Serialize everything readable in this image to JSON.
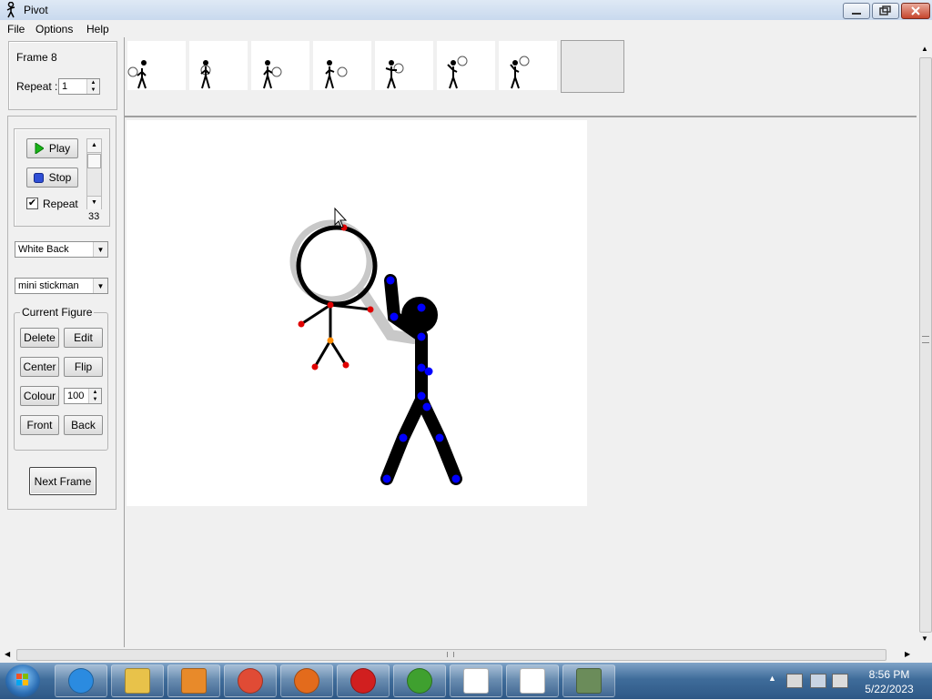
{
  "window": {
    "title": "Pivot"
  },
  "menu": {
    "file": "File",
    "options": "Options",
    "help": "Help"
  },
  "frame_panel": {
    "frame_label": "Frame 8",
    "repeat_label": "Repeat :",
    "repeat_value": "1"
  },
  "playback": {
    "play_label": "Play",
    "stop_label": "Stop",
    "repeat_label": "Repeat",
    "repeat_checked": true,
    "speed_value": "33"
  },
  "background_select": {
    "value": "White Back"
  },
  "figure_select": {
    "value": "mini stickman"
  },
  "current_figure": {
    "title": "Current Figure",
    "delete": "Delete",
    "edit": "Edit",
    "center": "Center",
    "flip": "Flip",
    "colour": "Colour",
    "colour_value": "100",
    "front": "Front",
    "back": "Back"
  },
  "next_frame_label": "Next Frame",
  "taskbar": {
    "time": "8:56 PM",
    "date": "5/22/2023",
    "apps": [
      "internet-explorer-icon",
      "folder-icon",
      "media-player-icon",
      "chrome-icon",
      "firefox-icon",
      "opera-icon",
      "utorrent-icon",
      "pivot-icon",
      "list-icon",
      "monitor-icon"
    ]
  },
  "colors": {
    "canvas": "#ffffff",
    "selected_handle": "#0000ff",
    "unselected_handle": "#ff0000",
    "pivot_handle": "#ff8c00"
  }
}
